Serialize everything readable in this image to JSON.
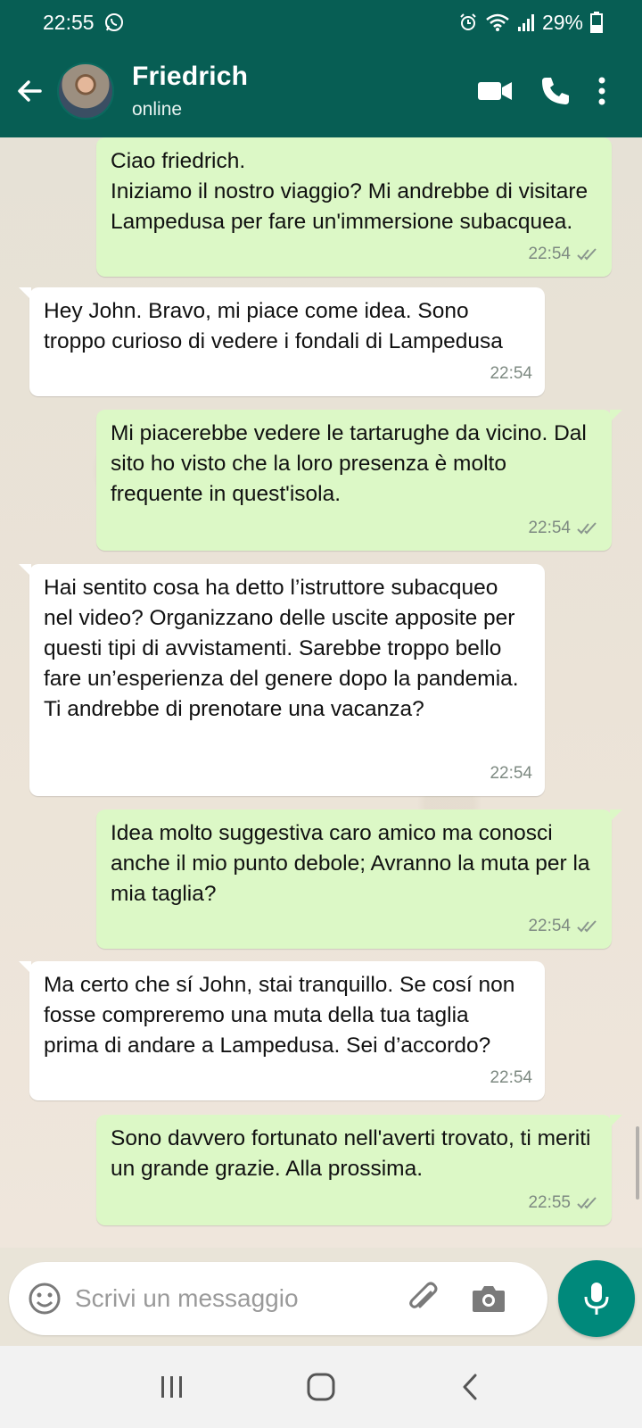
{
  "status_bar": {
    "time": "22:55",
    "battery": "29%",
    "icons": [
      "whatsapp-icon",
      "alarm-icon",
      "wifi-icon",
      "signal-icon",
      "battery-icon"
    ]
  },
  "header": {
    "contact_name": "Friedrich",
    "contact_status": "online",
    "icons": [
      "back-arrow-icon",
      "video-call-icon",
      "phone-icon",
      "more-options-icon"
    ]
  },
  "messages": [
    {
      "direction": "out",
      "text": "Ciao friedrich.\nIniziamo il nostro viaggio? Mi andrebbe di visitare Lampedusa per fare un'immersione subacquea.",
      "time": "22:54",
      "status": "read"
    },
    {
      "direction": "in",
      "text": "Hey John. Bravo, mi piace come idea. Sono troppo curioso di vedere i fondali di Lampedusa",
      "time": "22:54"
    },
    {
      "direction": "out",
      "text": "Mi piacerebbe vedere le tartarughe da vicino. Dal sito ho visto che la loro presenza è molto frequente in quest'isola.",
      "time": "22:54",
      "status": "read"
    },
    {
      "direction": "in",
      "text": "Hai sentito cosa ha detto l’istruttore subacqueo nel video? Organizzano delle uscite apposite per questi tipi di avvistamenti. Sarebbe troppo bello fare un’esperienza del genere dopo la pandemia. Ti andrebbe di prenotare una vacanza?",
      "time": "22:54"
    },
    {
      "direction": "out",
      "text": "Idea molto suggestiva caro amico ma conosci anche il mio punto debole; Avranno la muta per la mia taglia?",
      "time": "22:54",
      "status": "read"
    },
    {
      "direction": "in",
      "text": "Ma certo che sí John, stai tranquillo. Se cosí non fosse compreremo una muta della tua taglia prima di andare a Lampedusa. Sei d’accordo?",
      "time": "22:54"
    },
    {
      "direction": "out",
      "text": "Sono davvero fortunato nell'averti trovato, ti meriti un grande grazie. Alla prossima.",
      "time": "22:55",
      "status": "read"
    }
  ],
  "composer": {
    "placeholder": "Scrivi un messaggio",
    "icons": [
      "emoji-icon",
      "attach-icon",
      "camera-icon",
      "mic-icon"
    ]
  },
  "nav_bar": {
    "icons": [
      "recent-apps-icon",
      "home-icon",
      "back-icon"
    ]
  },
  "colors": {
    "header": "#075e54",
    "outgoing_bubble": "#dcf8c6",
    "incoming_bubble": "#ffffff",
    "accent": "#00897b",
    "chat_background": "#ebe3d7"
  }
}
